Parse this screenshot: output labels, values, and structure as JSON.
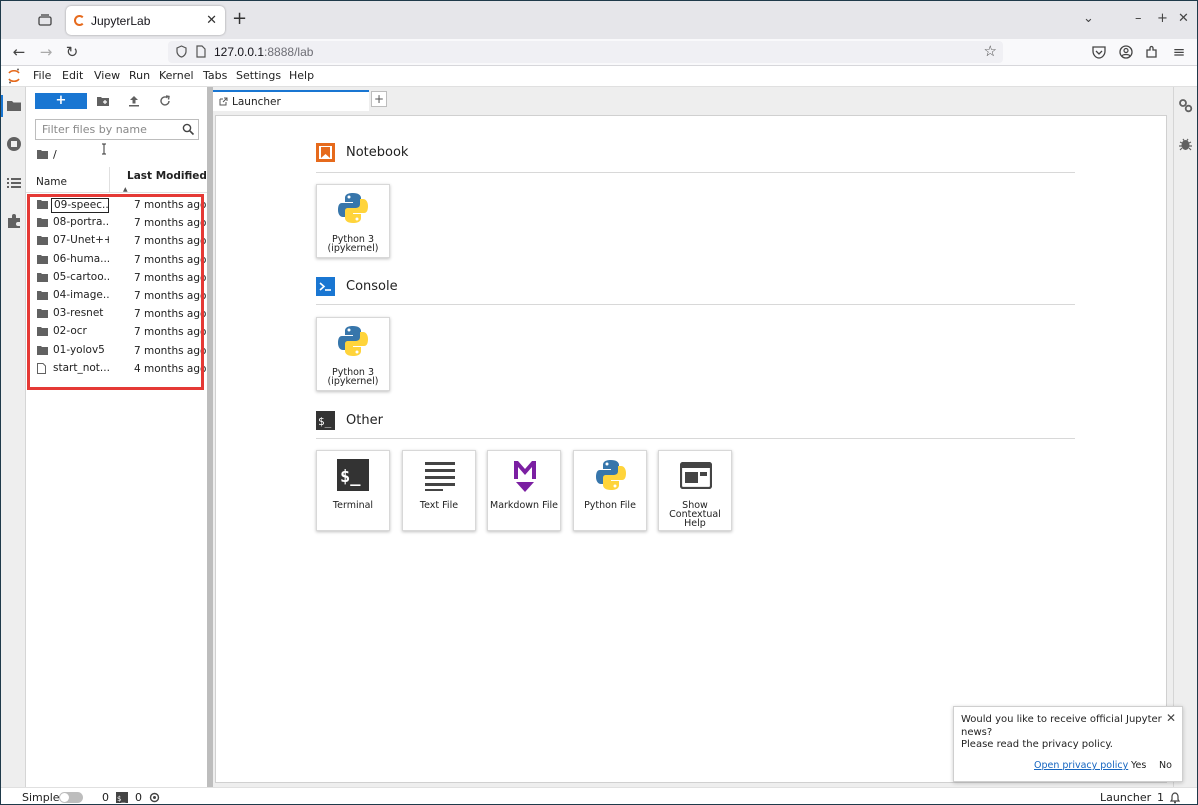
{
  "browser": {
    "tab_title": "JupyterLab",
    "url_host": "127.0.0.1",
    "url_rest": ":8888/lab"
  },
  "menubar": [
    "File",
    "Edit",
    "View",
    "Run",
    "Kernel",
    "Tabs",
    "Settings",
    "Help"
  ],
  "filebrowser": {
    "new_label": "+",
    "filter_placeholder": "Filter files by name",
    "breadcrumb": "/",
    "col_name": "Name",
    "col_modified": "Last Modified",
    "files": [
      {
        "name": "09-speec...",
        "modified": "7 months ago",
        "type": "folder"
      },
      {
        "name": "08-portra...",
        "modified": "7 months ago",
        "type": "folder"
      },
      {
        "name": "07-Unet++",
        "modified": "7 months ago",
        "type": "folder"
      },
      {
        "name": "06-huma...",
        "modified": "7 months ago",
        "type": "folder"
      },
      {
        "name": "05-cartoo...",
        "modified": "7 months ago",
        "type": "folder"
      },
      {
        "name": "04-image...",
        "modified": "7 months ago",
        "type": "folder"
      },
      {
        "name": "03-resnet",
        "modified": "7 months ago",
        "type": "folder"
      },
      {
        "name": "02-ocr",
        "modified": "7 months ago",
        "type": "folder"
      },
      {
        "name": "01-yolov5",
        "modified": "7 months ago",
        "type": "folder"
      },
      {
        "name": "start_not...",
        "modified": "4 months ago",
        "type": "file"
      }
    ]
  },
  "launcher": {
    "tab_label": "Launcher",
    "notebook": {
      "title": "Notebook",
      "cards": [
        {
          "line1": "Python 3",
          "line2": "(ipykernel)"
        }
      ]
    },
    "console": {
      "title": "Console",
      "cards": [
        {
          "line1": "Python 3",
          "line2": "(ipykernel)"
        }
      ]
    },
    "other": {
      "title": "Other",
      "cards": [
        {
          "line1": "Terminal"
        },
        {
          "line1": "Text File"
        },
        {
          "line1": "Markdown File"
        },
        {
          "line1": "Python File"
        },
        {
          "line1": "Show",
          "line2": "Contextual",
          "line3": "Help"
        }
      ]
    }
  },
  "notification": {
    "line1": "Would you like to receive official Jupyter news?",
    "line2": "Please read the privacy policy.",
    "link": "Open privacy policy",
    "yes": "Yes",
    "no": "No"
  },
  "statusbar": {
    "mode": "Simple",
    "terminals": "0",
    "kernels": "0",
    "active": "Launcher",
    "notif_count": "1"
  },
  "colors": {
    "accent": "#1976d2",
    "highlight": "#e53935",
    "orange": "#e66a1c"
  }
}
